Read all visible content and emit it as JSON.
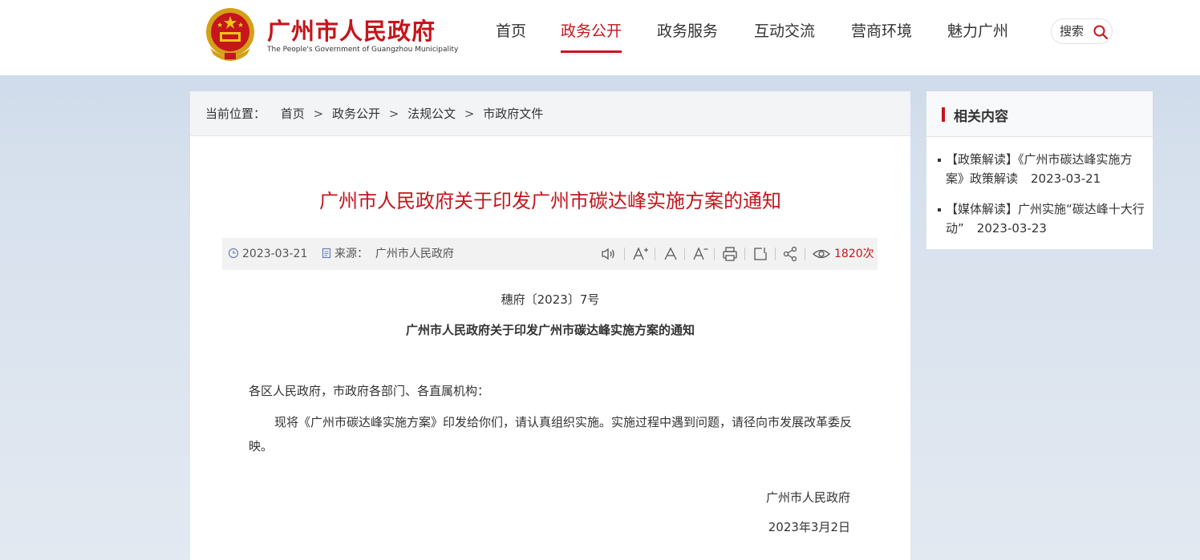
{
  "header": {
    "site_title": "广州市人民政府",
    "site_subtitle": "The People's Government of Guangzhou Municipality",
    "nav": [
      "首页",
      "政务公开",
      "政务服务",
      "互动交流",
      "营商环境",
      "魅力广州"
    ],
    "active_nav": "政务公开",
    "search_label": "搜索"
  },
  "breadcrumb": {
    "label": "当前位置：",
    "items": [
      "首页",
      "政务公开",
      "法规公文",
      "市政府文件"
    ],
    "separator": ">"
  },
  "article": {
    "title": "广州市人民政府关于印发广州市碳达峰实施方案的通知",
    "date": "2023-03-21",
    "source_label": "来源：",
    "source": "广州市人民政府",
    "view_count": "1820次",
    "tools": [
      "speaker-icon",
      "font-increase-icon",
      "font-reset-icon",
      "font-decrease-icon",
      "print-icon",
      "share-out-icon",
      "share-icon",
      "eye-icon"
    ],
    "doc_number": "穗府〔2023〕7号",
    "doc_heading": "广州市人民政府关于印发广州市碳达峰实施方案的通知",
    "salutation": "各区人民政府，市政府各部门、各直属机构：",
    "body": "现将《广州市碳达峰实施方案》印发给你们，请认真组织实施。实施过程中遇到问题，请径向市发展改革委反映。",
    "signature": "广州市人民政府",
    "sign_date": "2023年3月2日"
  },
  "related": {
    "title": "相关内容",
    "items": [
      {
        "text": "【政策解读】《广州市碳达峰实施方案》政策解读",
        "date": "2023-03-21"
      },
      {
        "text": "【媒体解读】广州实施“碳达峰十大行动”",
        "date": "2023-03-23"
      }
    ]
  },
  "colors": {
    "accent": "#c4161c",
    "background": "#d6e0ed"
  }
}
